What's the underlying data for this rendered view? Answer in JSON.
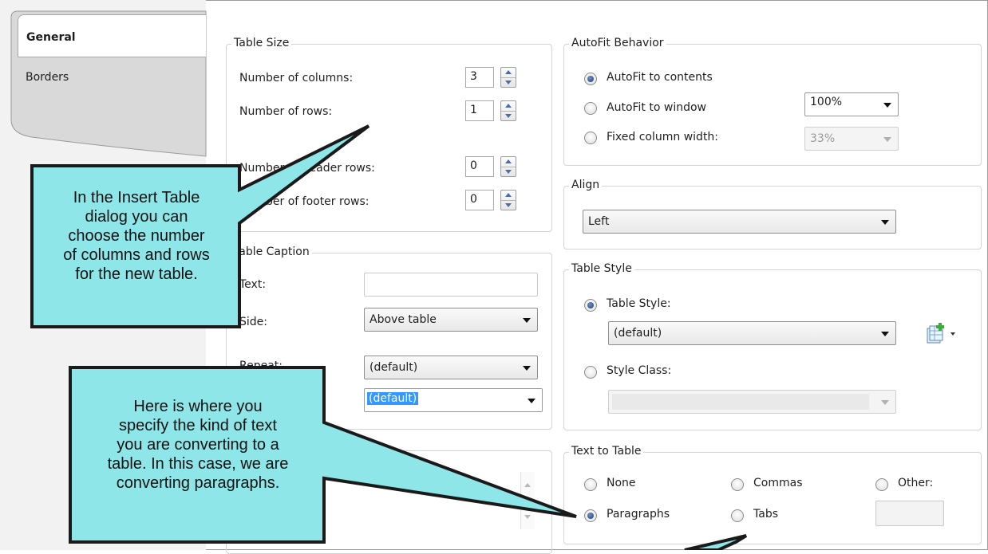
{
  "tabs": [
    {
      "label": "General",
      "active": true
    },
    {
      "label": "Borders",
      "active": false
    }
  ],
  "table_size": {
    "legend": "Table Size",
    "columns_label": "Number of columns:",
    "columns_value": "3",
    "rows_label": "Number of rows:",
    "rows_value": "1",
    "header_rows_label": "Number of header rows:",
    "header_rows_value": "0",
    "footer_rows_label": "Number of footer rows:",
    "footer_rows_value": "0"
  },
  "table_caption": {
    "legend": "Table Caption",
    "text_label": "Text:",
    "text_value": "",
    "side_label": "Side:",
    "side_value": "Above table",
    "repeat_label": "Repeat:",
    "repeat_value": "(default)",
    "fourth_value": "(default)"
  },
  "autofit": {
    "legend": "AutoFit Behavior",
    "opt_contents": "AutoFit to contents",
    "opt_window": "AutoFit to window",
    "window_value": "100%",
    "opt_fixed": "Fixed column width:",
    "fixed_value": "33%",
    "selected": "AutoFit to contents"
  },
  "align": {
    "legend": "Align",
    "value": "Left"
  },
  "table_style": {
    "legend": "Table Style",
    "opt_style": "Table Style:",
    "style_value": "(default)",
    "opt_class": "Style Class:",
    "class_value": "",
    "selected": "Table Style:"
  },
  "text_to_table": {
    "legend": "Text to Table",
    "opt_none": "None",
    "opt_commas": "Commas",
    "opt_other": "Other:",
    "opt_paragraphs": "Paragraphs",
    "opt_tabs": "Tabs",
    "selected": "Paragraphs"
  },
  "callouts": {
    "top_lines": [
      "In the Insert Table",
      "dialog you can",
      "choose the number",
      "of columns and rows",
      "for the new table."
    ],
    "bottom_lines": [
      "Here is where you",
      "specify the kind of text",
      "you are converting to a",
      "table. In this case, we are",
      "converting paragraphs."
    ]
  },
  "colors": {
    "callout_fill": "#8fe6e9",
    "callout_border": "#1a1a1a",
    "selection_blue": "#3399ff"
  },
  "icons": [
    "new-style-icon",
    "spin-up-icon",
    "spin-down-icon",
    "dropdown-arrow-icon"
  ]
}
